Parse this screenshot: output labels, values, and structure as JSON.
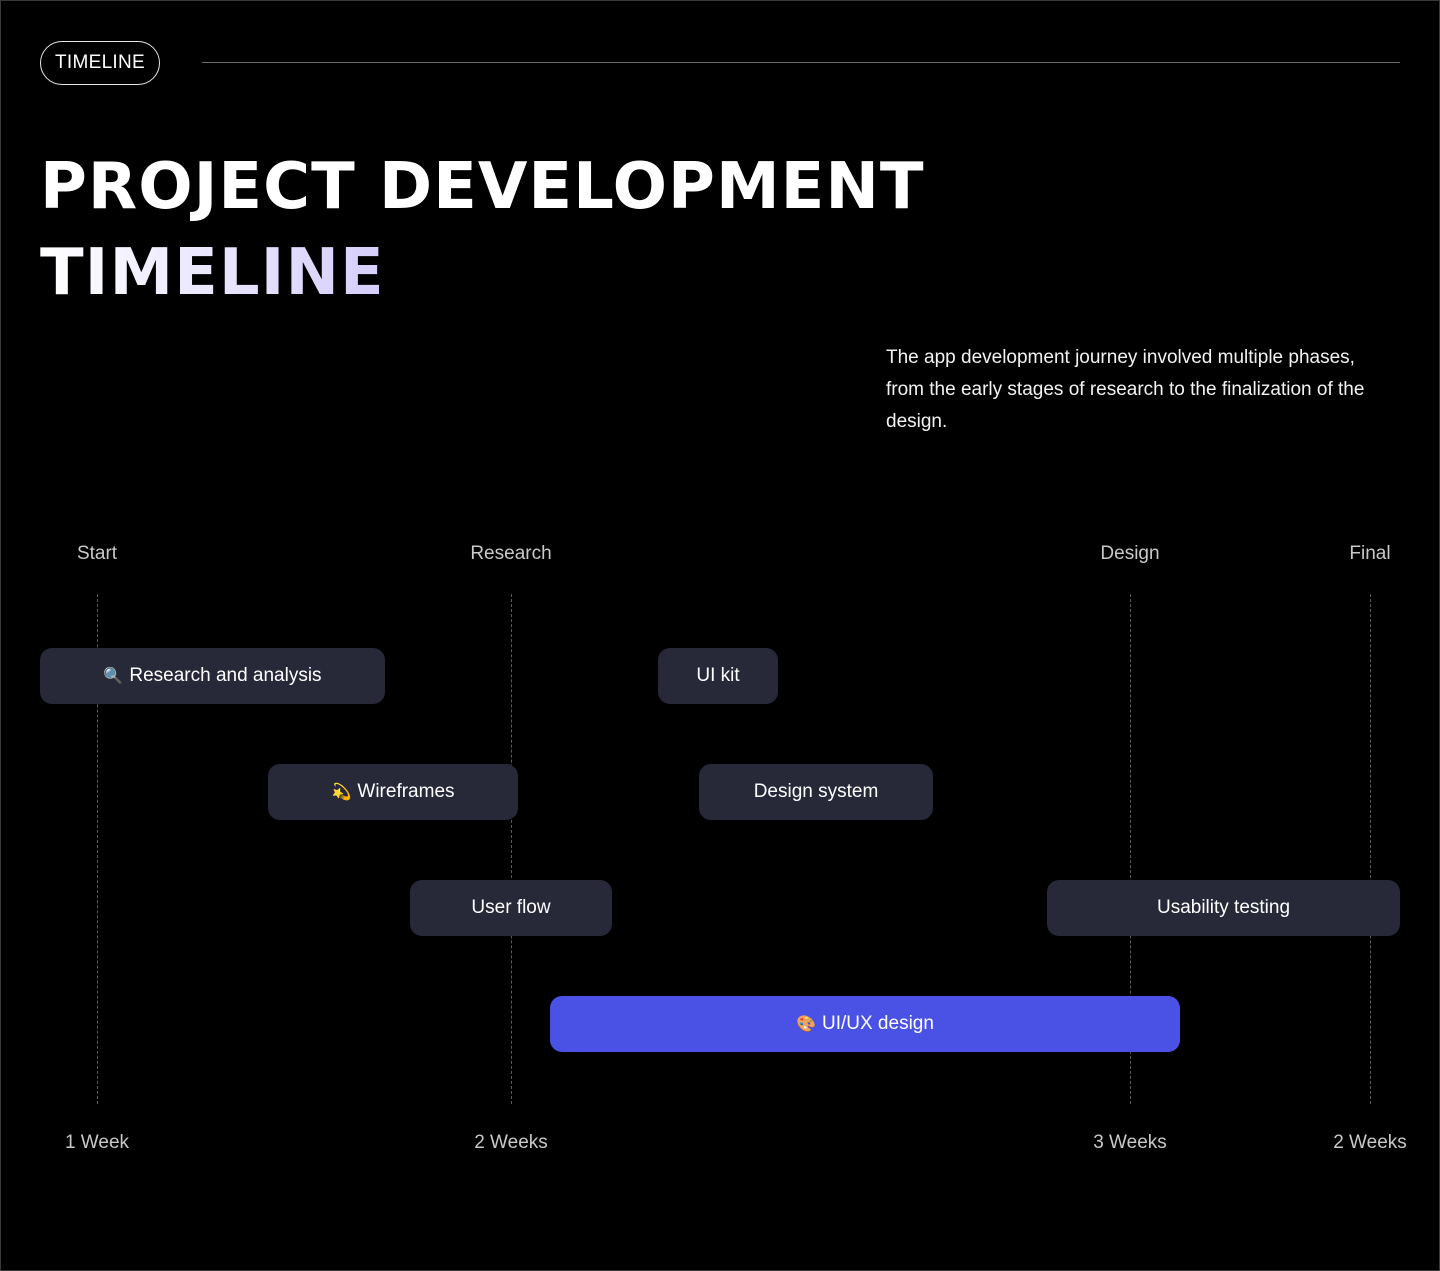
{
  "tag": {
    "label": "TIMELINE"
  },
  "title": {
    "line1": "PROJECT DEVELOPMENT",
    "line2": "TIMELINE"
  },
  "description": "The app development journey involved multiple phases, from the early stages of research to the finalization of the design.",
  "milestones": [
    {
      "label": "Start",
      "duration": "1 Week"
    },
    {
      "label": "Research",
      "duration": "2 Weeks"
    },
    {
      "label": "Design",
      "duration": "3 Weeks"
    },
    {
      "label": "Final",
      "duration": "2 Weeks"
    }
  ],
  "tasks": [
    {
      "id": "research-and-analysis",
      "label": "Research and analysis",
      "icon": "magnifier-icon",
      "glyph": "🔍",
      "highlight": false
    },
    {
      "id": "ui-kit",
      "label": "UI kit",
      "icon": "",
      "glyph": "",
      "highlight": false
    },
    {
      "id": "wireframes",
      "label": "Wireframes",
      "icon": "dizzy-star-icon",
      "glyph": "💫",
      "highlight": false
    },
    {
      "id": "design-system",
      "label": "Design system",
      "icon": "",
      "glyph": "",
      "highlight": false
    },
    {
      "id": "user-flow",
      "label": "User flow",
      "icon": "",
      "glyph": "",
      "highlight": false
    },
    {
      "id": "usability-testing",
      "label": "Usability testing",
      "icon": "",
      "glyph": "",
      "highlight": false
    },
    {
      "id": "ui-ux-design",
      "label": "UI/UX design",
      "icon": "palette-icon",
      "glyph": "🎨",
      "highlight": true
    }
  ],
  "colors": {
    "background": "#000000",
    "task": "#272838",
    "highlight": "#4a52e6",
    "accent_gradient_end": "#a99cf0"
  }
}
